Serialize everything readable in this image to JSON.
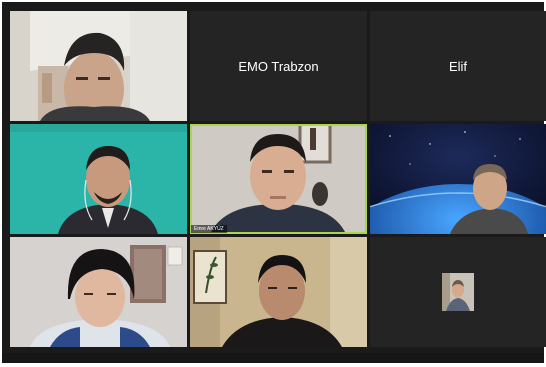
{
  "tiles": [
    {
      "id": "p1",
      "type": "video",
      "caption": ""
    },
    {
      "id": "p2",
      "type": "name",
      "label": "EMO Trabzon"
    },
    {
      "id": "p3",
      "type": "name",
      "label": "Elif"
    },
    {
      "id": "p4",
      "type": "video",
      "caption": ""
    },
    {
      "id": "p5",
      "type": "video",
      "caption": "Emre AKYÜZ",
      "active": true
    },
    {
      "id": "p6",
      "type": "video",
      "caption": ""
    },
    {
      "id": "p7",
      "type": "video",
      "caption": ""
    },
    {
      "id": "p8",
      "type": "video",
      "caption": ""
    },
    {
      "id": "p9",
      "type": "avatar",
      "caption": ""
    }
  ],
  "colors": {
    "window_bg": "#1a1a1a",
    "tile_bg": "#242424",
    "active_border": "#a8d84a",
    "teal_wall": "#2bb5a8"
  }
}
